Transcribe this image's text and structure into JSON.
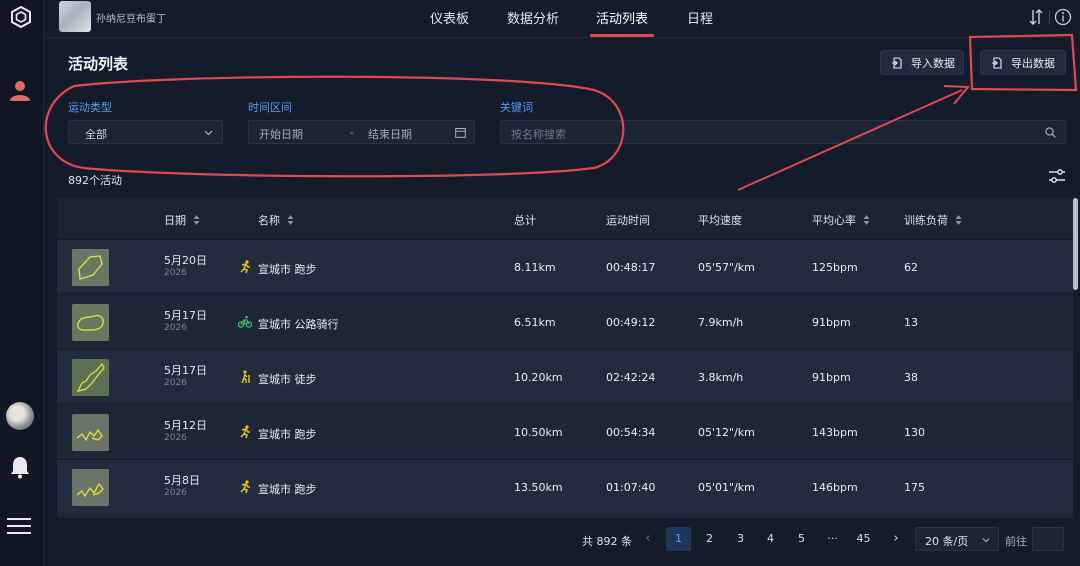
{
  "topbar": {
    "username": "孙纳尼豆布蛋丁",
    "nav": [
      {
        "label": "仪表板",
        "active": false
      },
      {
        "label": "数据分析",
        "active": false
      },
      {
        "label": "活动列表",
        "active": true
      },
      {
        "label": "日程",
        "active": false
      }
    ]
  },
  "header": {
    "title": "活动列表",
    "import_label": "导入数据",
    "export_label": "导出数据"
  },
  "filters": {
    "type_label": "运动类型",
    "type_value": "全部",
    "date_label": "时间区间",
    "start_placeholder": "开始日期",
    "date_separator": "-",
    "end_placeholder": "结束日期",
    "keyword_label": "关键词",
    "keyword_placeholder": "按名称搜索"
  },
  "activity_count": "892个活动",
  "table": {
    "columns": [
      "日期",
      "名称",
      "总计",
      "运动时间",
      "平均速度",
      "平均心率",
      "训练负荷"
    ],
    "rows": [
      {
        "date": "5月20日",
        "year": "2026",
        "sport": "run",
        "name": "宣城市 跑步",
        "total": "8.11km",
        "time": "00:48:17",
        "speed": "05'57\"/km",
        "hr": "125bpm",
        "load": "62"
      },
      {
        "date": "5月17日",
        "year": "2026",
        "sport": "bike",
        "name": "宣城市 公路骑行",
        "total": "6.51km",
        "time": "00:49:12",
        "speed": "7.9km/h",
        "hr": "91bpm",
        "load": "13"
      },
      {
        "date": "5月17日",
        "year": "2026",
        "sport": "hike",
        "name": "宣城市 徒步",
        "total": "10.20km",
        "time": "02:42:24",
        "speed": "3.8km/h",
        "hr": "91bpm",
        "load": "38"
      },
      {
        "date": "5月12日",
        "year": "2026",
        "sport": "run",
        "name": "宣城市 跑步",
        "total": "10.50km",
        "time": "00:54:34",
        "speed": "05'12\"/km",
        "hr": "143bpm",
        "load": "130"
      },
      {
        "date": "5月8日",
        "year": "2026",
        "sport": "run",
        "name": "宣城市 跑步",
        "total": "13.50km",
        "time": "01:07:40",
        "speed": "05'01\"/km",
        "hr": "146bpm",
        "load": "175"
      }
    ]
  },
  "pagination": {
    "total_label": "共 892 条",
    "pages": [
      "1",
      "2",
      "3",
      "4",
      "5",
      "···",
      "45"
    ],
    "current": "1",
    "per_page": "20 条/页",
    "goto_label": "前往"
  },
  "colors": {
    "accent": "#5b9cf2",
    "annotation": "#e04a4a",
    "sidebar_user": "#e06a6a",
    "route": "#d9e63a"
  }
}
